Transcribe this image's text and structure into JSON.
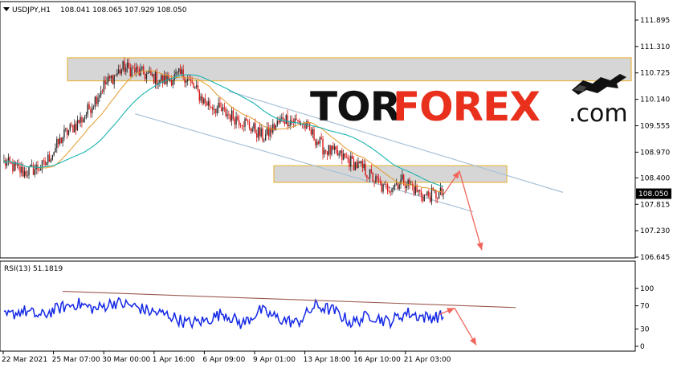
{
  "window": {
    "symbol_label": "USDJPY,H1",
    "ohlc_label": "108.041 108.065 107.929 108.050",
    "rsi_label": "RSI(13) 51.1819",
    "current_price": "108.050"
  },
  "watermark": {
    "tor": "TOR",
    "forex": "FOREX",
    "com": ".com"
  },
  "colors": {
    "bull_candle": "#2a2a2a",
    "bear_candle": "#d81818",
    "ma_fast": "#e39a2a",
    "ma_slow": "#19b3b0",
    "channel": "#a9c1d6",
    "zone_fill": "#d6d6d6",
    "zone_border": "#e8b84a",
    "forecast": "#f0645a",
    "rsi_line": "#1428e6",
    "rsi_trend": "#9b5a50",
    "logo_red": "#e8301c"
  },
  "chart_data": [
    {
      "type": "candlestick",
      "title": "USDJPY,H1",
      "price_ticks": [
        "111.895",
        "111.310",
        "110.725",
        "110.140",
        "109.555",
        "108.970",
        "108.400",
        "107.815",
        "107.230",
        "106.645"
      ],
      "ylim": [
        106.645,
        111.895
      ],
      "time_ticks": [
        "22 Mar 2021",
        "25 Mar 07:00",
        "30 Mar 00:00",
        "1 Apr 16:00",
        "6 Apr 09:00",
        "9 Apr 01:00",
        "13 Apr 18:00",
        "16 Apr 10:00",
        "21 Apr 03:00"
      ],
      "close_anchors": [
        108.75,
        108.52,
        108.67,
        109.35,
        109.75,
        110.45,
        110.85,
        110.7,
        110.55,
        110.7,
        110.1,
        109.85,
        109.65,
        109.3,
        109.72,
        109.6,
        109.05,
        108.85,
        108.6,
        108.15,
        108.35,
        108.0,
        108.05
      ],
      "zones": [
        {
          "name": "resistance",
          "top": 111.06,
          "bottom": 110.55
        },
        {
          "name": "support",
          "top": 108.67,
          "bottom": 108.3
        }
      ],
      "channel": {
        "upper": [
          [
            5.0,
            110.32
          ],
          [
            23.0,
            108.08
          ]
        ],
        "lower": [
          [
            4.7,
            109.82
          ],
          [
            19.5,
            107.65
          ]
        ]
      },
      "forecast": [
        [
          19.7,
          108.05
        ],
        [
          20.4,
          108.55
        ],
        [
          21.4,
          106.8
        ]
      ]
    },
    {
      "type": "line",
      "title": "RSI(13) 51.1819",
      "levels": [
        "100",
        "70",
        "30",
        "0"
      ],
      "ylim": [
        0,
        100
      ],
      "rsi_anchors": [
        50,
        62,
        52,
        66,
        74,
        64,
        76,
        70,
        60,
        54,
        40,
        44,
        58,
        38,
        62,
        48,
        40,
        70,
        62,
        40,
        54,
        42,
        58,
        50,
        52
      ],
      "trendline": [
        [
          78,
          95
        ],
        [
          642,
          67
        ]
      ],
      "forecast": [
        [
          547,
          55
        ],
        [
          566,
          66
        ],
        [
          593,
          2
        ]
      ]
    }
  ]
}
